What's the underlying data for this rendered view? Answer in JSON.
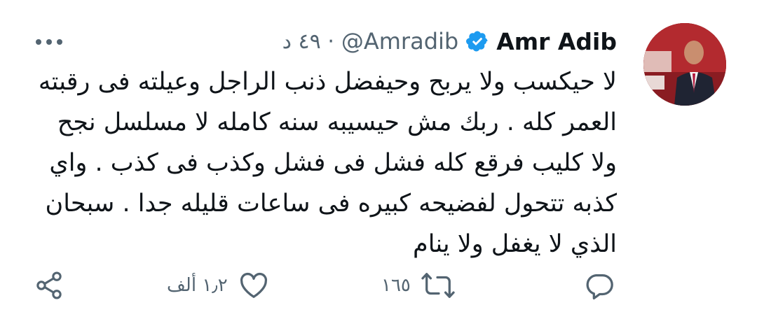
{
  "tweet": {
    "display_name": "Amr Adib",
    "handle": "@Amradib",
    "meta": "· ٤٩ د",
    "text": "لا حيكسب ولا يربح وحيفضل ذنب الراجل وعيلته فى رقبته العمر كله . ربك مش حيسيبه سنه كامله لا مسلسل نجح ولا كليب فرقع كله فشل فى فشل وكذب فى كذب . واي كذبه تتحول لفضيحه كبيره فى ساعات قليله جدا . سبحان الذي لا يغفل ولا ينام"
  },
  "actions": {
    "reply": {
      "icon": "reply-icon"
    },
    "retweet": {
      "icon": "retweet-icon",
      "count": "١٦٥"
    },
    "like": {
      "icon": "heart-icon",
      "count": "١٫٢ ألف"
    },
    "share": {
      "icon": "share-icon"
    }
  },
  "colors": {
    "text": "#0f1419",
    "secondary": "#536471",
    "verified": "#1d9bf0"
  }
}
